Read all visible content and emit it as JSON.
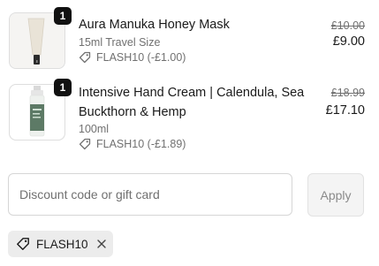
{
  "items": [
    {
      "qty": "1",
      "title": "Aura Manuka Honey Mask",
      "variant": "15ml Travel Size",
      "discount": "FLASH10 (-£1.00)",
      "compare_price": "£10.00",
      "price": "£9.00"
    },
    {
      "qty": "1",
      "title_line1": "Intensive Hand Cream | Calendula, Sea",
      "title_line2": "Buckthorn & Hemp",
      "variant": "100ml",
      "discount": "FLASH10 (-£1.89)",
      "compare_price": "£18.99",
      "price": "£17.10"
    }
  ],
  "discount_form": {
    "placeholder": "Discount code or gift card",
    "apply_label": "Apply"
  },
  "applied_code": {
    "code": "FLASH10"
  },
  "icons": {
    "tag": "tag-icon",
    "remove": "close-icon"
  }
}
